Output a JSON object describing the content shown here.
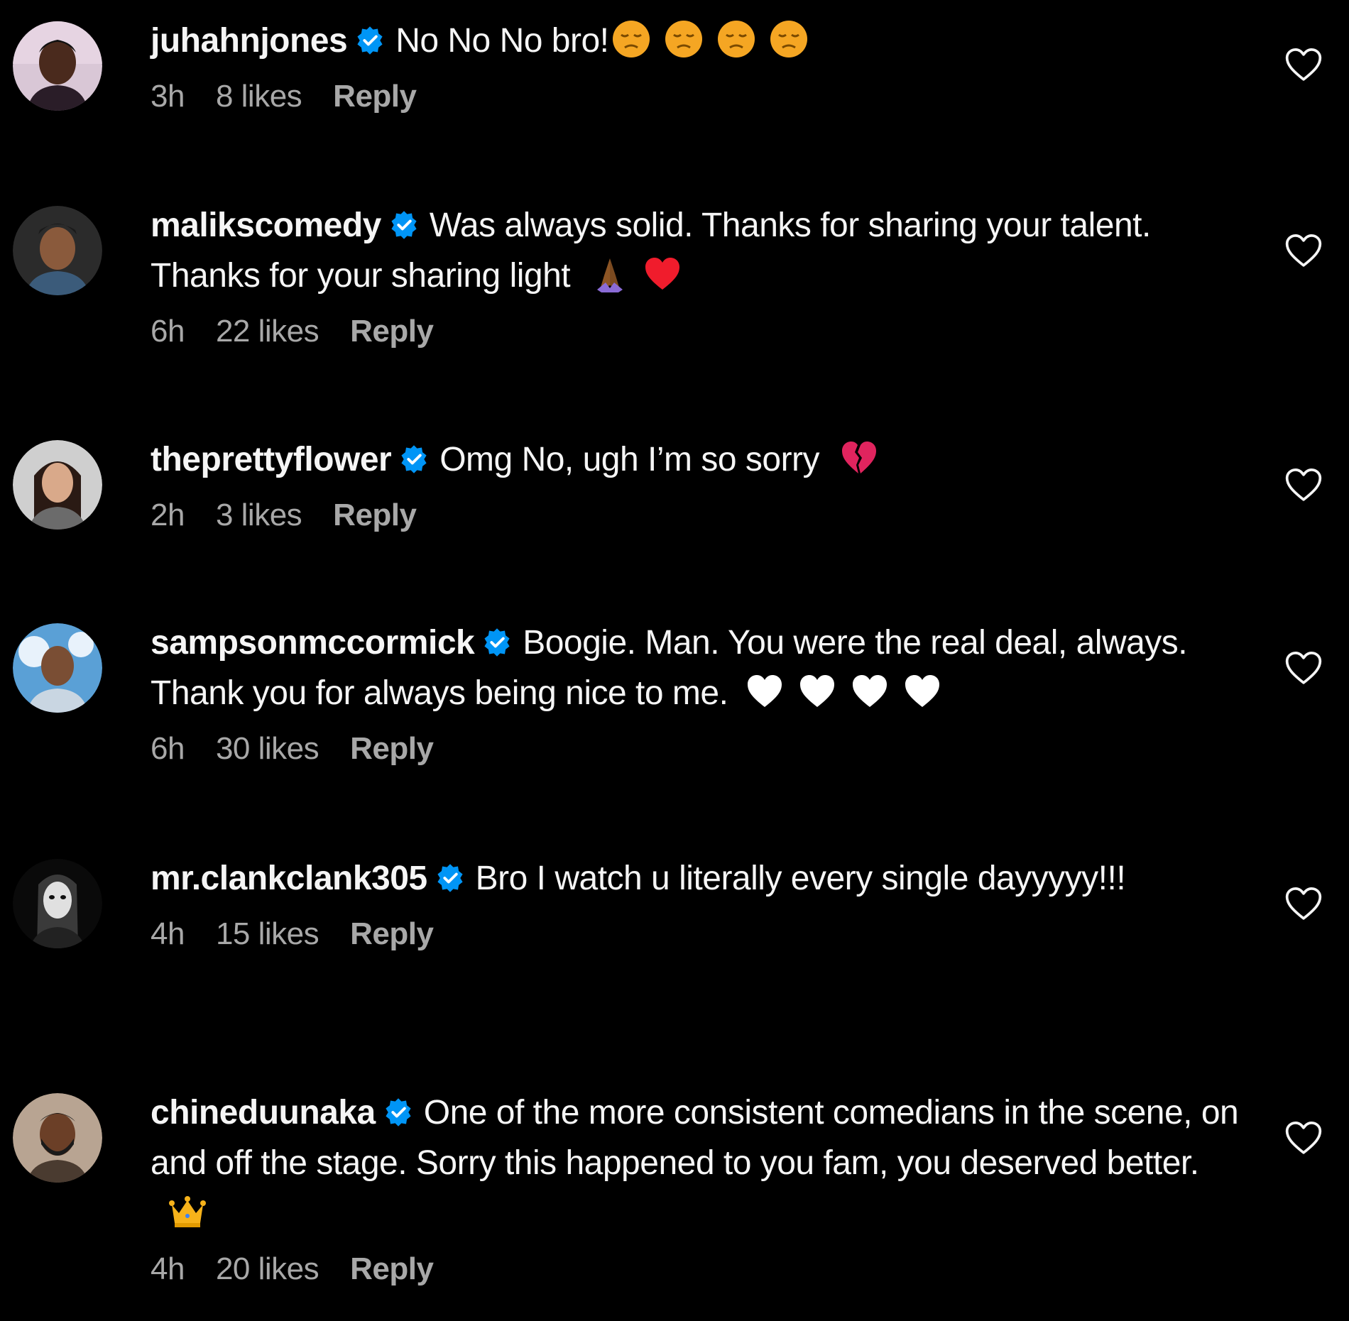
{
  "comments": [
    {
      "username": "juhahnjones",
      "text": "No No No bro!",
      "emojis": [
        "pensive-face",
        "pensive-face",
        "pensive-face",
        "pensive-face"
      ],
      "time": "3h",
      "likes": "8 likes",
      "reply": "Reply",
      "avatar": "avatar-juhahnjones"
    },
    {
      "username": "malikscomedy",
      "text": "Was always solid. Thanks for sharing your talent. Thanks for your sharing light",
      "emojis": [
        "folded-hands",
        "red-heart"
      ],
      "time": "6h",
      "likes": "22 likes",
      "reply": "Reply",
      "avatar": "avatar-malikscomedy"
    },
    {
      "username": "theprettyflower",
      "text": "Omg No, ugh I’m so sorry",
      "emojis": [
        "broken-heart"
      ],
      "time": "2h",
      "likes": "3 likes",
      "reply": "Reply",
      "avatar": "avatar-theprettyflower"
    },
    {
      "username": "sampsonmccormick",
      "text": "Boogie. Man. You were the real deal, always. Thank you for always being nice to me.",
      "emojis": [
        "white-heart",
        "white-heart",
        "white-heart",
        "white-heart"
      ],
      "time": "6h",
      "likes": "30 likes",
      "reply": "Reply",
      "avatar": "avatar-sampsonmccormick"
    },
    {
      "username": "mr.clankclank305",
      "text": "Bro I watch u literally every single dayyyyy!!!",
      "emojis": [],
      "time": "4h",
      "likes": "15 likes",
      "reply": "Reply",
      "avatar": "avatar-mrclankclank305"
    },
    {
      "username": "chineduunaka",
      "text": "One of the more consistent comedians in the scene, on and off the stage. Sorry this happened to you fam, you deserved better.",
      "emojis": [
        "crown"
      ],
      "time": "4h",
      "likes": "20 likes",
      "reply": "Reply",
      "avatar": "avatar-chineduunaka"
    }
  ],
  "colors": {
    "background": "#000000",
    "primary_text": "#f5f5f5",
    "secondary_text": "#a8a8a8",
    "verified_badge": "#0095f6"
  },
  "icons": {
    "verified": "verified-badge-icon",
    "like": "heart-outline-icon"
  }
}
